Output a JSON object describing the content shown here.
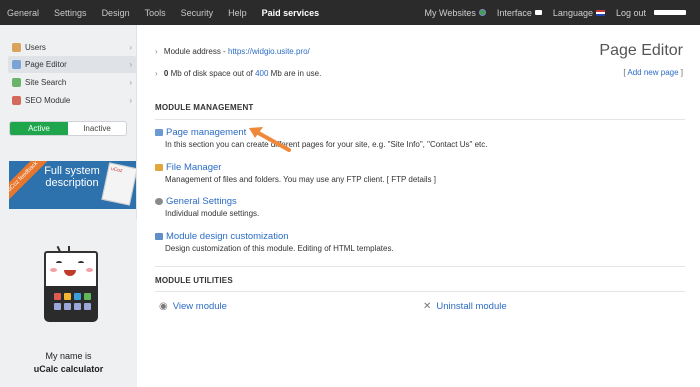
{
  "topbar": {
    "nav": [
      "General",
      "Settings",
      "Design",
      "Tools",
      "Security",
      "Help",
      "Paid services"
    ],
    "right": {
      "websites": "My Websites",
      "interface": "Interface",
      "language": "Language",
      "logout": "Log out"
    }
  },
  "sidebar": {
    "items": [
      {
        "label": "Users",
        "icon": "users-icon",
        "color": "#d9a35b"
      },
      {
        "label": "Page Editor",
        "icon": "page-editor-icon",
        "color": "#7aa3d6"
      },
      {
        "label": "Site Search",
        "icon": "search-icon",
        "color": "#6ab46a"
      },
      {
        "label": "SEO Module",
        "icon": "seo-icon",
        "color": "#d36a5a"
      }
    ],
    "toggle": {
      "active": "Active",
      "inactive": "Inactive"
    },
    "banner": {
      "ribbon": "uCoz feedback",
      "text": "Full system description",
      "book": "uCoz"
    },
    "calc": {
      "line1": "My name is",
      "line2": "uCalc calculator"
    }
  },
  "main": {
    "address_prefix": "Module address - ",
    "address_link": "https://widgio.usite.pro/",
    "disk_used": "0",
    "disk_middle": " Mb of disk space out of ",
    "disk_total": "400",
    "disk_suffix": " Mb are in use.",
    "page_title": "Page Editor",
    "add_page_open": "[ ",
    "add_page_link": "Add new page",
    "add_page_close": " ]",
    "management_header": "MODULE MANAGEMENT",
    "modules": [
      {
        "title": "Page management",
        "desc": "In this section you can create different pages for your site, e.g. \"Site Info\", \"Contact Us\" etc.",
        "icon": "page-management-icon",
        "color": "#6b9ad2"
      },
      {
        "title": "File Manager",
        "desc": "Management of files and folders. You may use any FTP client. [ FTP details ]",
        "icon": "file-manager-icon",
        "color": "#e0a73a"
      },
      {
        "title": "General Settings",
        "desc": "Individual module settings.",
        "icon": "general-settings-icon",
        "color": "#8a8a8a"
      },
      {
        "title": "Module design customization",
        "desc": "Design customization of this module. Editing of HTML templates.",
        "icon": "design-customization-icon",
        "color": "#5f8fc9"
      }
    ],
    "utilities_header": "MODULE UTILITIES",
    "view_module": "View module",
    "uninstall_module": "Uninstall module"
  },
  "colors": {
    "accent": "#2b6cc4",
    "active_green": "#1fa64d",
    "topbar": "#2b2b2b",
    "arrow": "#f0883a"
  }
}
